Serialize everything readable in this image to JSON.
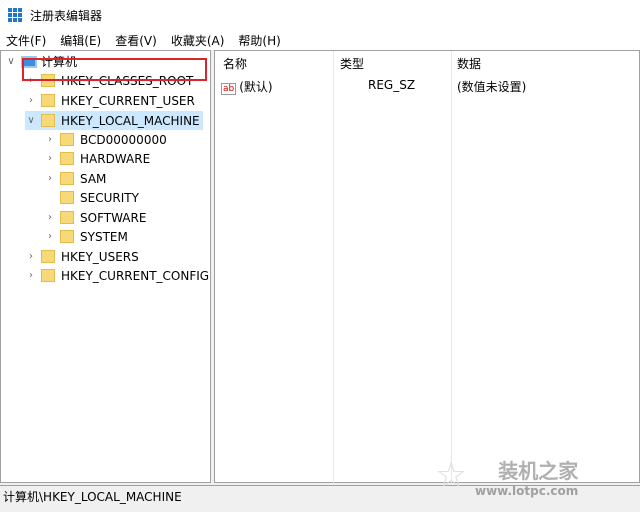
{
  "window": {
    "title": "注册表编辑器"
  },
  "menu": [
    "文件(F)",
    "编辑(E)",
    "查看(V)",
    "收藏夹(A)",
    "帮助(H)"
  ],
  "tree": {
    "root": "计算机",
    "hives": [
      "HKEY_CLASSES_ROOT",
      "HKEY_CURRENT_USER",
      "HKEY_LOCAL_MACHINE",
      "HKEY_USERS",
      "HKEY_CURRENT_CONFIG"
    ],
    "hklm_children": [
      "BCD00000000",
      "HARDWARE",
      "SAM",
      "SECURITY",
      "SOFTWARE",
      "SYSTEM"
    ]
  },
  "list": {
    "columns": [
      "名称",
      "类型",
      "数据"
    ],
    "rows": [
      {
        "name": "(默认)",
        "type": "REG_SZ",
        "data": "(数值未设置)"
      }
    ]
  },
  "status": "计算机\\HKEY_LOCAL_MACHINE",
  "watermark": {
    "name": "装机之家",
    "url": "www.lotpc.com"
  }
}
